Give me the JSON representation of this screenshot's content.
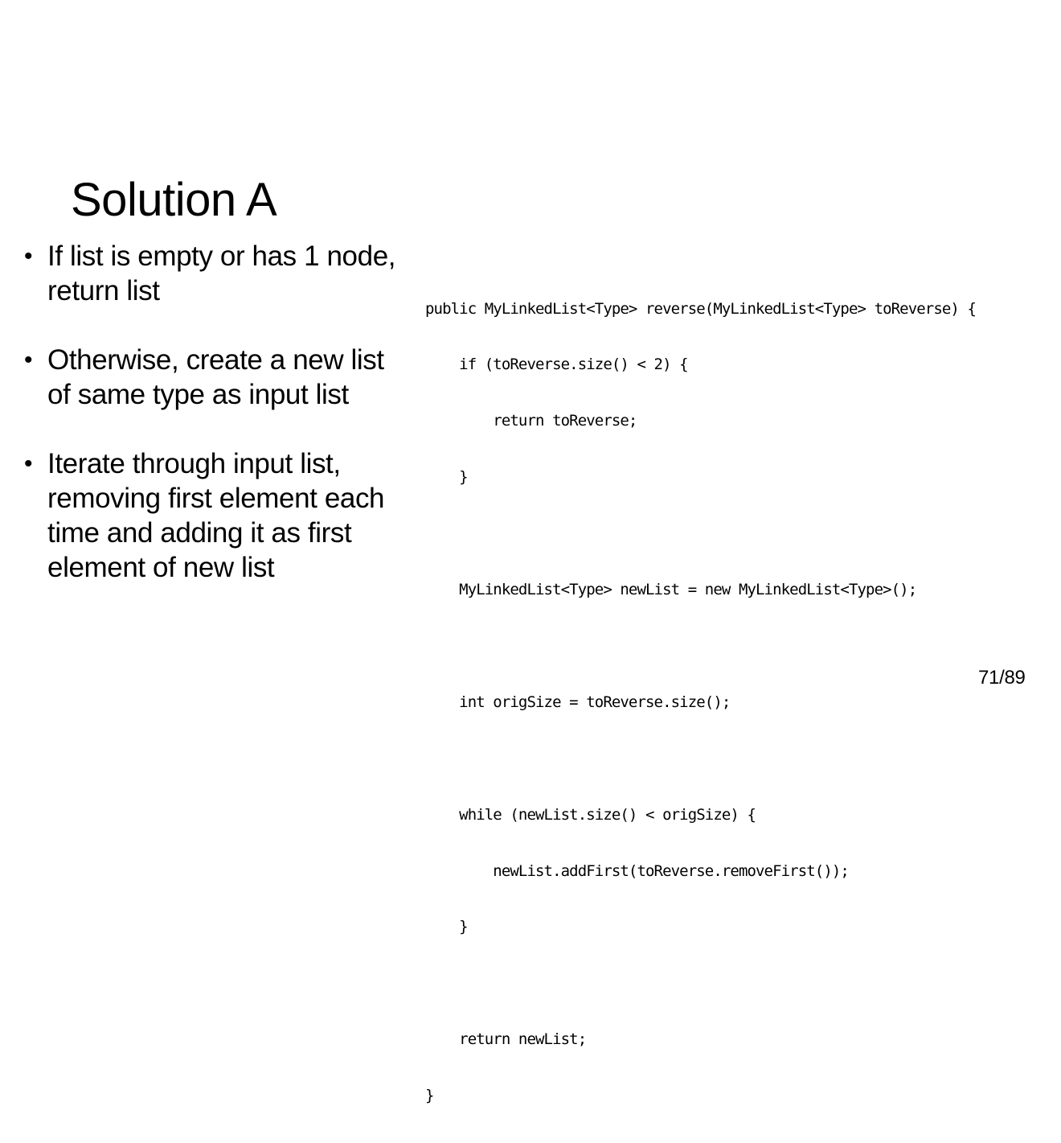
{
  "slide": {
    "title": "Solution A",
    "bullets": [
      "If list is empty or has 1 node, return list",
      "Otherwise, create a new list of same type as input list",
      "Iterate through input list, removing first element each time and adding it as first element of new list"
    ],
    "code_lines": [
      "public MyLinkedList<Type> reverse(MyLinkedList<Type> toReverse) {",
      "    if (toReverse.size() < 2) {",
      "        return toReverse;",
      "    }",
      "",
      "    MyLinkedList<Type> newList = new MyLinkedList<Type>();",
      "",
      "    int origSize = toReverse.size();",
      "",
      "    while (newList.size() < origSize) {",
      "        newList.addFirst(toReverse.removeFirst());",
      "    }",
      "",
      "    return newList;",
      "}"
    ],
    "page_number": "71/89"
  }
}
